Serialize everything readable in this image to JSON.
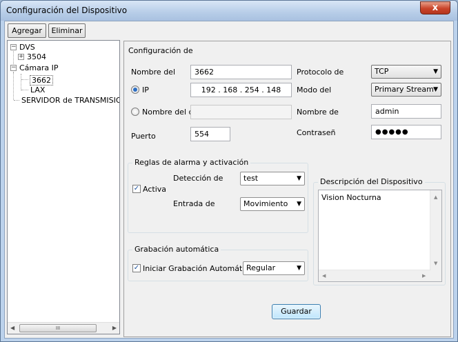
{
  "window": {
    "title": "Configuración del Dispositivo",
    "close_glyph": "x"
  },
  "toolbar": {
    "add_label": "Agregar",
    "delete_label": "Eliminar"
  },
  "tree": {
    "dvs": "DVS",
    "dvs_child": "3504",
    "camera": "Cámara IP",
    "camera_child_1": "3662",
    "camera_child_2": "LAX",
    "server": "SERVIDOR de TRANSMISION",
    "scroll_grip": "III"
  },
  "config": {
    "section_title": "Configuración de",
    "name_label": "Nombre del",
    "name_value": "3662",
    "ip_radio_label": "IP",
    "ip_value": "192  .  168  .  254  .  148",
    "domain_radio_label": "Nombre del dc",
    "domain_value": "",
    "port_label": "Puerto",
    "port_value": "554",
    "protocol_label": "Protocolo de",
    "protocol_value": "TCP",
    "mode_label": "Modo del",
    "mode_value": "Primary Stream",
    "user_label": "Nombre de",
    "user_value": "admin",
    "password_label": "Contraseñ",
    "password_value": "●●●●●"
  },
  "alarm": {
    "group_title": "Reglas de alarma y activación",
    "active_label": "Activa",
    "detection_label": "Detección de",
    "detection_value": "test",
    "input_label": "Entrada de",
    "input_value": "Movimiento"
  },
  "recording": {
    "group_title": "Grabación automática",
    "start_label": "Iniciar Grabación Automática",
    "mode_value": "Regular"
  },
  "description": {
    "group_title": "Descripción del Dispositivo",
    "text": "Vision Nocturna"
  },
  "actions": {
    "save_label": "Guardar"
  },
  "glyphs": {
    "dropdown": "▼",
    "check": "✓",
    "minus": "−",
    "plus": "+",
    "left": "◀",
    "right": "▶",
    "up": "▲",
    "down": "▼"
  }
}
